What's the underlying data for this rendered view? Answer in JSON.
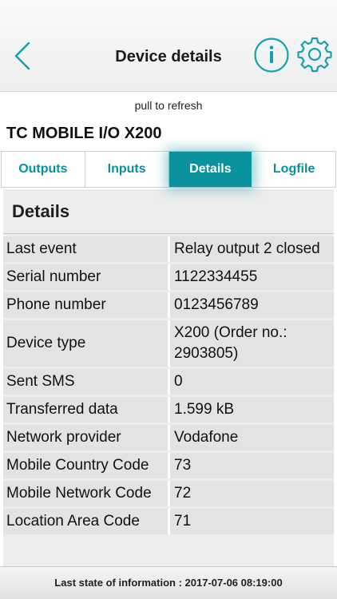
{
  "header": {
    "title": "Device details",
    "back_icon": "chevron-left-icon",
    "info_icon": "info-icon",
    "settings_icon": "gear-icon",
    "accent_color": "#0a929d"
  },
  "pull_to_refresh": "pull to refresh",
  "device_name": "TC MOBILE I/O X200",
  "tabs": [
    {
      "label": "Outputs",
      "active": false
    },
    {
      "label": "Inputs",
      "active": false
    },
    {
      "label": "Details",
      "active": true
    },
    {
      "label": "Logfile",
      "active": false
    }
  ],
  "section": {
    "title": "Details",
    "rows": [
      {
        "label": "Last event",
        "value": "Relay output 2 closed"
      },
      {
        "label": "Serial number",
        "value": "1122334455"
      },
      {
        "label": "Phone number",
        "value": "0123456789"
      },
      {
        "label": "Device type",
        "value": "X200 (Order no.: 2903805)"
      },
      {
        "label": "Sent SMS",
        "value": "0"
      },
      {
        "label": "Transferred data",
        "value": "1.599 kB"
      },
      {
        "label": "Network provider",
        "value": "Vodafone"
      },
      {
        "label": "Mobile Country Code",
        "value": "73"
      },
      {
        "label": "Mobile Network Code",
        "value": "72"
      },
      {
        "label": "Location Area Code",
        "value": "71"
      }
    ]
  },
  "footer": {
    "text": "Last state of information : 2017-07-06 08:19:00"
  }
}
